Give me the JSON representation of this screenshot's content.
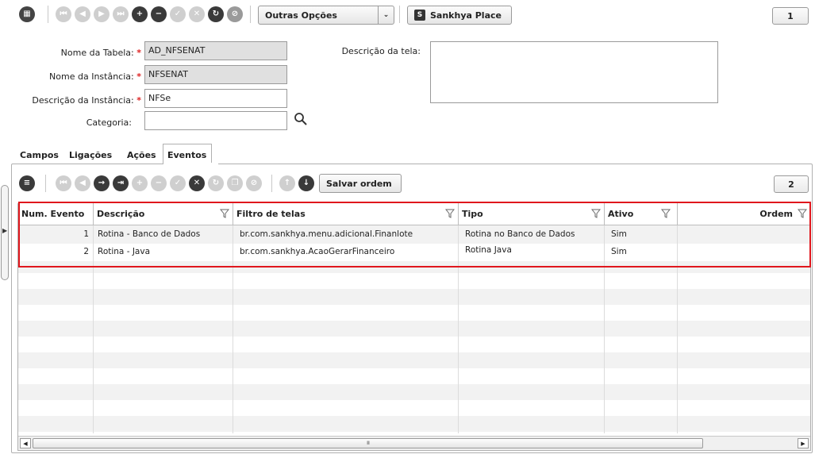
{
  "toolbar": {
    "more_options_label": "Outras Opções",
    "place_label": "Sankhya Place",
    "page_indicator": "1"
  },
  "form": {
    "table_name_label": "Nome da Tabela:",
    "table_name_value": "AD_NFSENAT",
    "instance_name_label": "Nome da Instância:",
    "instance_name_value": "NFSENAT",
    "instance_desc_label": "Descrição da Instância:",
    "instance_desc_value": "NFSe",
    "category_label": "Categoria:",
    "category_value": "",
    "screen_desc_label": "Descrição da tela:",
    "screen_desc_value": "",
    "required_mark": "*"
  },
  "tabs": [
    {
      "label": "Campos"
    },
    {
      "label": "Ligações"
    },
    {
      "label": "Ações"
    },
    {
      "label": "Eventos"
    }
  ],
  "grid_toolbar": {
    "save_order_label": "Salvar ordem",
    "page_indicator": "2"
  },
  "grid": {
    "columns": [
      "Num. Evento",
      "Descrição",
      "Filtro de telas",
      "Tipo",
      "Ativo",
      "Ordem"
    ],
    "rows": [
      [
        "1",
        "Rotina - Banco de Dados",
        "br.com.sankhya.menu.adicional.Finanlote",
        "Rotina no Banco de Dados",
        "Sim",
        ""
      ],
      [
        "2",
        "Rotina - Java",
        "br.com.sankhya.AcaoGerarFinanceiro",
        "Rotina Java",
        "Sim",
        ""
      ]
    ],
    "scroll_thumb_glyph": "IIII"
  },
  "colors": {
    "highlight": "#e0171d",
    "required": "#d22222"
  }
}
